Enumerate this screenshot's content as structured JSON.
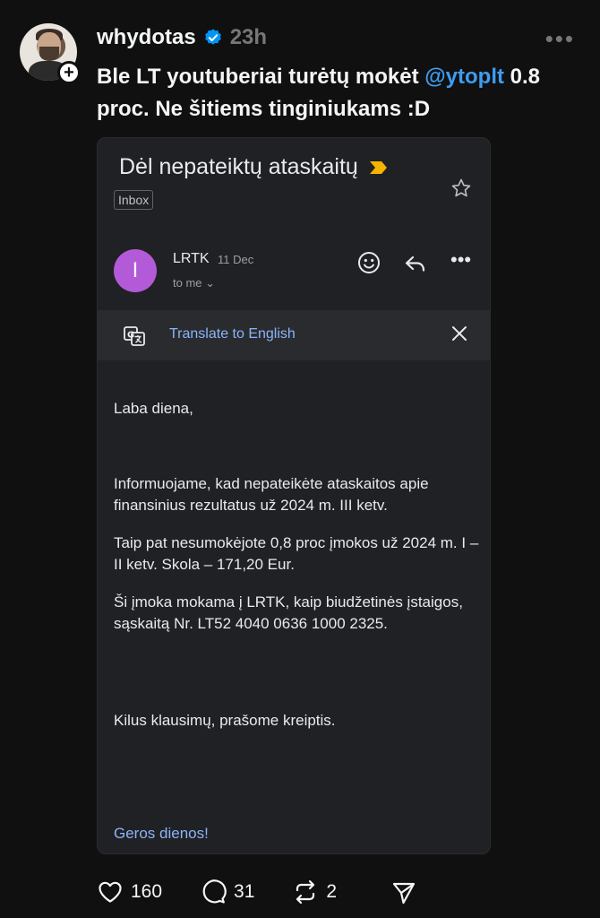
{
  "post": {
    "username": "whydotas",
    "timestamp": "23h",
    "text_before": "Ble LT youtuberiai turėtų mokėt ",
    "mention": "@ytoplt",
    "text_after": " 0.8 proc. Ne šitiems tinginiukams :D"
  },
  "email": {
    "subject": "Dėl nepateiktų ataskaitų",
    "label": "Inbox",
    "sender_initial": "I",
    "sender_name": "LRTK",
    "date": "11 Dec",
    "to": "to me",
    "translate": "Translate to English",
    "greeting": "Laba diena,",
    "paragraphs": [
      "Informuojame, kad nepateikėte ataskaitos apie finansinius rezultatus už 2024 m. III ketv.",
      "Taip pat nesumokėjote 0,8 proc įmokos už 2024 m. I – II ketv. Skola – 171,20 Eur.",
      "Ši įmoka mokama į LRTK, kaip biudžetinės įstaigos, sąskaitą Nr. LT52 4040 0636 1000 2325.",
      "Kilus klausimų, prašome kreiptis."
    ],
    "signoff": "Geros dienos!"
  },
  "actions": {
    "likes": "160",
    "replies": "31",
    "reposts": "2"
  },
  "colors": {
    "background": "#101010",
    "mention": "#3f9cf0",
    "verified": "#0095f6",
    "avatar_sender": "#b35ad8",
    "link": "#8ab4f8",
    "important": "#f4b400"
  },
  "icons": [
    "verified-icon",
    "follow-plus-icon",
    "more-icon",
    "important-marker-icon",
    "star-icon",
    "emoji-icon",
    "reply-icon",
    "translate-icon",
    "close-icon",
    "heart-icon",
    "comment-icon",
    "repost-icon",
    "share-icon"
  ]
}
